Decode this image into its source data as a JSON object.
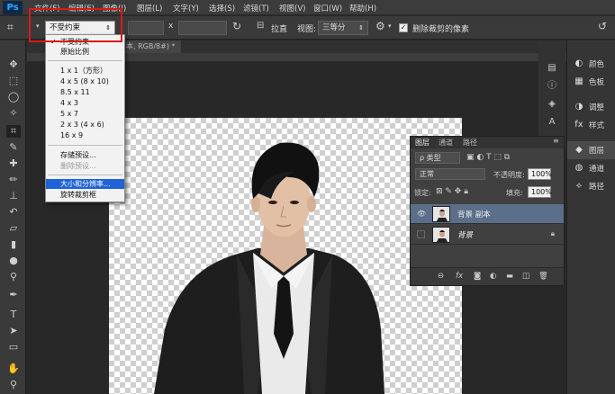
{
  "app": {
    "logo": "Ps"
  },
  "menu": [
    "文件(F)",
    "编辑(E)",
    "图像(I)",
    "图层(L)",
    "文字(Y)",
    "选择(S)",
    "滤镜(T)",
    "视图(V)",
    "窗口(W)",
    "帮助(H)"
  ],
  "options_bar": {
    "ratio_selected": "不受约束",
    "times_sign": "x",
    "straighten_label": "拉直",
    "view_label": "视图:",
    "view_value": "三等分",
    "delete_cropped_label": "删除裁剪的像素"
  },
  "document": {
    "tab_title": "本, RGB/8#) *"
  },
  "ratio_dropdown": {
    "items": [
      {
        "label": "不受约束",
        "checked": true
      },
      {
        "label": "原始比例"
      },
      {
        "label": "1 x 1（方形）"
      },
      {
        "label": "4 x 5 (8 x 10)"
      },
      {
        "label": "8.5 x 11"
      },
      {
        "label": "4 x 3"
      },
      {
        "label": "5 x 7"
      },
      {
        "label": "2 x 3 (4 x 6)"
      },
      {
        "label": "16 x 9"
      },
      {
        "label": "存储预设..."
      },
      {
        "label": "删除预设...",
        "disabled": true
      },
      {
        "label": "大小和分辨率...",
        "highlighted": true
      },
      {
        "label": "旋转裁剪框"
      }
    ]
  },
  "right_panel": {
    "items": [
      {
        "icon": "palette-icon",
        "label": "颜色"
      },
      {
        "icon": "swatches-icon",
        "label": "色板"
      },
      {
        "icon": "adjustments-icon",
        "label": "调整"
      },
      {
        "icon": "styles-icon",
        "label": "样式"
      },
      {
        "icon": "layers-icon",
        "label": "图层"
      },
      {
        "icon": "channels-icon",
        "label": "通道"
      },
      {
        "icon": "paths-icon",
        "label": "路径"
      }
    ]
  },
  "layers_panel": {
    "tabs": [
      "图层",
      "通道",
      "路径"
    ],
    "filter_kind": "ρ 类型",
    "blend_mode": "正常",
    "opacity_label": "不透明度:",
    "opacity_value": "100%",
    "lock_label": "锁定:",
    "fill_label": "填充:",
    "fill_value": "100%",
    "layers": [
      {
        "name": "背景 副本",
        "visible": true,
        "selected": true
      },
      {
        "name": "背景",
        "visible": false,
        "locked": true
      }
    ],
    "footer_icons": [
      "link-icon",
      "fx-icon",
      "mask-icon",
      "adjustment-layer-icon",
      "group-icon",
      "new-layer-icon",
      "trash-icon"
    ]
  },
  "colors": {
    "highlight_blue": "#1f63d6",
    "annotation_red": "#d81a1a",
    "selected_layer": "#5b6e8a"
  }
}
